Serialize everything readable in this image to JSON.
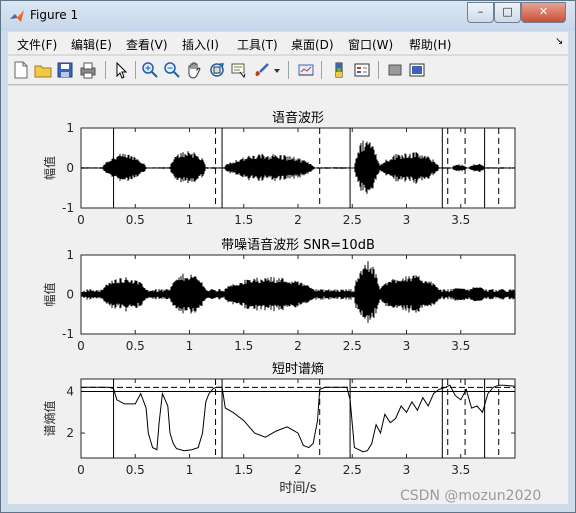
{
  "window": {
    "title": "Figure 1",
    "minimize": "–",
    "maximize": "□",
    "close": "✕"
  },
  "menu": {
    "items": [
      "文件(F)",
      "编辑(E)",
      "查看(V)",
      "插入(I)",
      "工具(T)",
      "桌面(D)",
      "窗口(W)",
      "帮助(H)"
    ],
    "dock_arrow": "↘"
  },
  "toolbar": {
    "icons": [
      "new-figure-icon",
      "open-file-icon",
      "save-icon",
      "print-icon",
      "pointer-icon",
      "zoom-in-icon",
      "zoom-out-icon",
      "pan-hand-icon",
      "rotate-3d-icon",
      "data-cursor-icon",
      "brush-icon",
      "brush-dropdown-icon",
      "link-plot-icon",
      "colorbar-icon",
      "legend-icon",
      "hide-plot-tools-icon",
      "show-plot-tools-icon"
    ]
  },
  "watermark": "CSDN @mozun2020",
  "chart_data": [
    {
      "type": "line",
      "title": "语音波形",
      "ylabel": "幅值",
      "xlabel": "",
      "xlim": [
        0,
        4
      ],
      "ylim": [
        -1,
        1
      ],
      "xticks": [
        "0",
        "0.5",
        "1",
        "1.5",
        "2",
        "2.5",
        "3",
        "3.5"
      ],
      "yticks": [
        "-1",
        "0",
        "1"
      ],
      "segments": [
        [
          0.2,
          0.6,
          0.35
        ],
        [
          0.82,
          1.15,
          0.45
        ],
        [
          1.32,
          2.15,
          0.35
        ],
        [
          2.52,
          2.75,
          0.75
        ],
        [
          2.75,
          3.3,
          0.4
        ],
        [
          3.42,
          3.55,
          0.08
        ],
        [
          3.58,
          3.72,
          0.1
        ]
      ],
      "solid_markers": [
        0.3,
        1.3,
        2.48,
        3.33,
        3.72
      ],
      "dashed_markers": [
        1.24,
        2.2,
        3.38,
        3.54,
        3.85
      ]
    },
    {
      "type": "line",
      "title": "带噪语音波形 SNR=10dB",
      "ylabel": "幅值",
      "xlabel": "",
      "xlim": [
        0,
        4
      ],
      "ylim": [
        -1,
        1
      ],
      "xticks": [
        "0",
        "0.5",
        "1",
        "1.5",
        "2",
        "2.5",
        "3",
        "3.5"
      ],
      "yticks": [
        "-1",
        "0",
        "1"
      ],
      "noise_level": 0.1,
      "segments": [
        [
          0.2,
          0.6,
          0.35
        ],
        [
          0.82,
          1.15,
          0.45
        ],
        [
          1.32,
          2.15,
          0.35
        ],
        [
          2.52,
          2.75,
          0.75
        ],
        [
          2.75,
          3.3,
          0.4
        ],
        [
          3.42,
          3.55,
          0.08
        ],
        [
          3.58,
          3.72,
          0.1
        ]
      ]
    },
    {
      "type": "line",
      "title": "短时谱熵",
      "ylabel": "谱熵值",
      "xlabel": "时间/s",
      "xlim": [
        0,
        4
      ],
      "ylim": [
        0.8,
        4.6
      ],
      "xticks": [
        "0",
        "0.5",
        "1",
        "1.5",
        "2",
        "2.5",
        "3",
        "3.5"
      ],
      "yticks": [
        "2",
        "4"
      ],
      "thresholds": [
        4.2,
        4.0
      ],
      "series": [
        {
          "x": [
            0,
            0.25,
            0.3,
            0.33,
            0.4,
            0.5,
            0.55,
            0.6,
            0.62,
            0.66,
            0.7,
            0.72,
            0.75,
            0.8,
            0.82,
            0.85,
            0.88,
            0.95,
            1.02,
            1.08,
            1.12,
            1.15,
            1.18,
            1.22,
            1.25,
            1.28,
            1.3,
            1.33,
            1.4,
            1.5,
            1.6,
            1.7,
            1.8,
            1.9,
            2.0,
            2.05,
            2.1,
            2.14,
            2.18,
            2.2,
            2.25,
            2.3,
            2.4,
            2.45,
            2.48,
            2.52,
            2.56,
            2.6,
            2.64,
            2.68,
            2.72,
            2.76,
            2.8,
            2.85,
            2.9,
            2.95,
            3.0,
            3.05,
            3.1,
            3.15,
            3.2,
            3.25,
            3.3,
            3.33,
            3.36,
            3.4,
            3.45,
            3.5,
            3.55,
            3.6,
            3.65,
            3.7,
            3.75,
            3.8,
            3.85,
            3.9,
            4.0
          ],
          "y": [
            4.2,
            4.2,
            4.15,
            3.6,
            3.4,
            3.4,
            3.9,
            3.2,
            2.0,
            1.3,
            1.2,
            2.5,
            3.9,
            3.3,
            2.0,
            1.5,
            1.25,
            1.15,
            1.2,
            1.3,
            2.0,
            3.5,
            3.9,
            4.15,
            4.2,
            4.2,
            4.2,
            3.2,
            3.0,
            2.6,
            2.0,
            1.8,
            2.1,
            2.3,
            2.0,
            1.4,
            1.3,
            1.5,
            2.6,
            4.1,
            4.2,
            4.2,
            4.2,
            4.2,
            3.6,
            1.3,
            1.2,
            1.1,
            1.15,
            1.5,
            2.4,
            2.0,
            2.9,
            2.5,
            2.7,
            3.3,
            3.0,
            3.5,
            3.1,
            3.7,
            3.3,
            3.9,
            4.1,
            4.15,
            4.2,
            4.3,
            3.8,
            3.6,
            4.1,
            3.2,
            3.3,
            3.0,
            3.9,
            4.2,
            4.3,
            4.3,
            4.25
          ]
        }
      ]
    }
  ]
}
